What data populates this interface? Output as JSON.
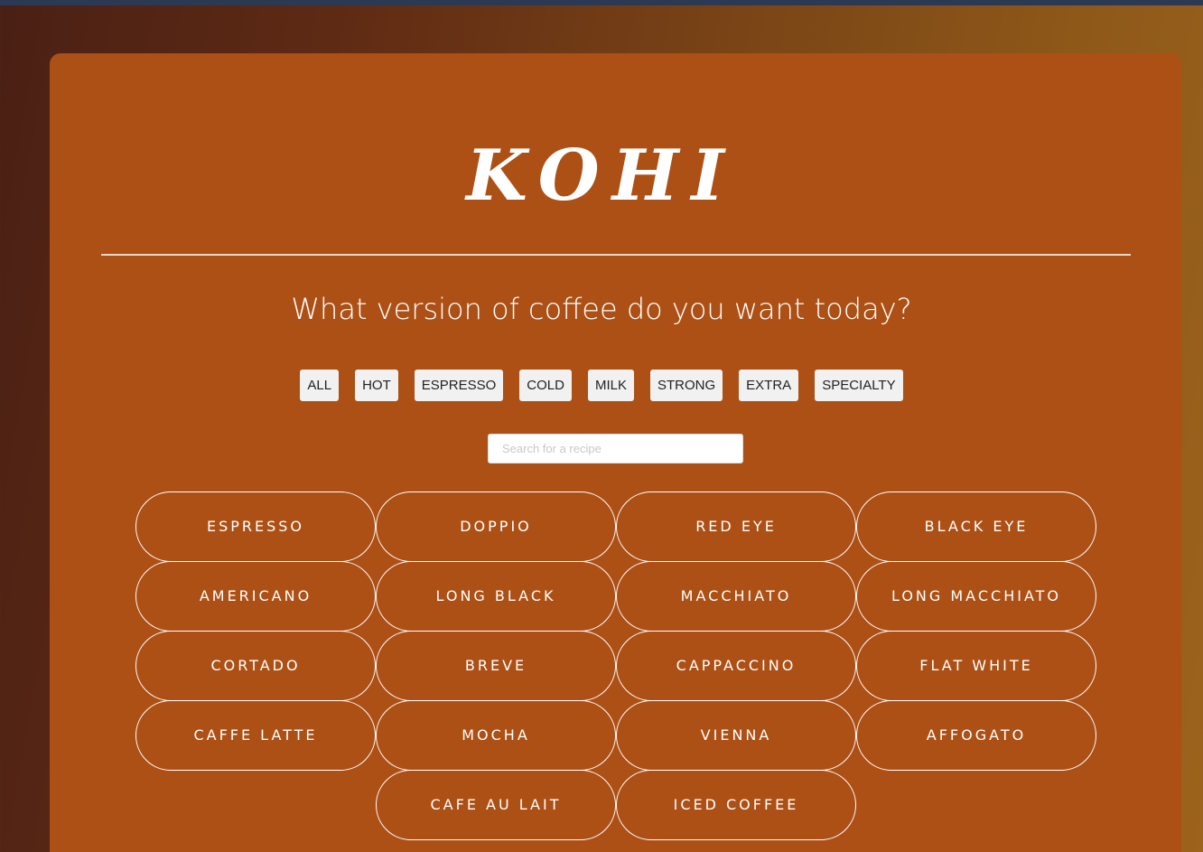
{
  "app": {
    "logo": "KOHI",
    "tagline": "What version of coffee do you want today?"
  },
  "filters": [
    {
      "label": "ALL"
    },
    {
      "label": "HOT"
    },
    {
      "label": "ESPRESSO"
    },
    {
      "label": "COLD"
    },
    {
      "label": "MILK"
    },
    {
      "label": "STRONG"
    },
    {
      "label": "EXTRA"
    },
    {
      "label": "SPECIALTY"
    }
  ],
  "search": {
    "placeholder": "Search for a recipe",
    "value": ""
  },
  "recipes": [
    [
      "ESPRESSO",
      "DOPPIO",
      "RED EYE",
      "BLACK EYE"
    ],
    [
      "AMERICANO",
      "LONG BLACK",
      "MACCHIATO",
      "LONG MACCHIATO"
    ],
    [
      "CORTADO",
      "BREVE",
      "CAPPACCINO",
      "FLAT WHITE"
    ],
    [
      "CAFFE LATTE",
      "MOCHA",
      "VIENNA",
      "AFFOGATO"
    ],
    [
      "CAFE AU LAIT",
      "ICED COFFEE"
    ]
  ],
  "colors": {
    "card": "#ad5015",
    "accent_text": "#ffffff",
    "filter_bg": "#f1f1f1"
  }
}
